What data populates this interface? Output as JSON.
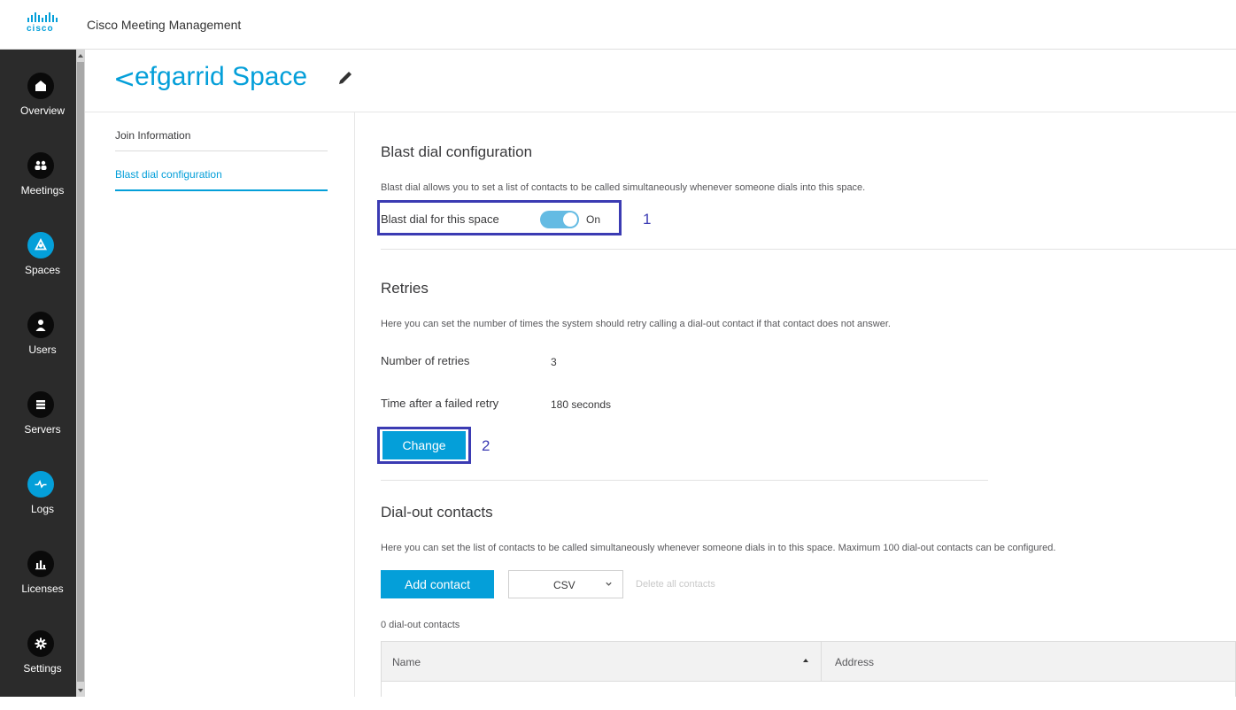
{
  "app": {
    "logo_text": "cisco",
    "title": "Cisco Meeting Management"
  },
  "nav": {
    "items": [
      {
        "label": "Overview",
        "icon": "home-icon",
        "active": false
      },
      {
        "label": "Meetings",
        "icon": "meetings-icon",
        "active": false
      },
      {
        "label": "Spaces",
        "icon": "spaces-icon",
        "active": true
      },
      {
        "label": "Users",
        "icon": "user-icon",
        "active": false
      },
      {
        "label": "Servers",
        "icon": "servers-icon",
        "active": false
      },
      {
        "label": "Logs",
        "icon": "logs-icon",
        "active": true
      },
      {
        "label": "Licenses",
        "icon": "licenses-icon",
        "active": false
      },
      {
        "label": "Settings",
        "icon": "gear-icon",
        "active": false
      }
    ]
  },
  "page": {
    "back": "<",
    "title": "efgarrid Space"
  },
  "subnav": {
    "items": [
      {
        "label": "Join Information"
      },
      {
        "label": "Blast dial configuration"
      }
    ]
  },
  "blast": {
    "heading": "Blast dial configuration",
    "description": "Blast dial allows you to set a list of contacts to be called simultaneously whenever someone dials into this space.",
    "toggle_label": "Blast dial for this space",
    "toggle_state": "On"
  },
  "retries": {
    "heading": "Retries",
    "description": "Here you can set the number of times the system should retry calling a dial-out contact if that contact does not answer.",
    "number_label": "Number of retries",
    "number_value": "3",
    "time_label": "Time after a failed retry",
    "time_value": "180 seconds",
    "change_button": "Change"
  },
  "contacts": {
    "heading": "Dial-out contacts",
    "description": "Here you can set the list of contacts to be called simultaneously whenever someone dials in to this space. Maximum 100 dial-out contacts can be configured.",
    "add_button": "Add contact",
    "format_select": "CSV",
    "delete_all": "Delete all contacts",
    "count_text": "0 dial-out contacts",
    "columns": [
      "Name",
      "Address"
    ]
  },
  "annotations": [
    "1",
    "2"
  ],
  "colors": {
    "accent": "#049fd9",
    "annotation": "#3b3bb3",
    "nav_bg": "#2b2b2b"
  }
}
